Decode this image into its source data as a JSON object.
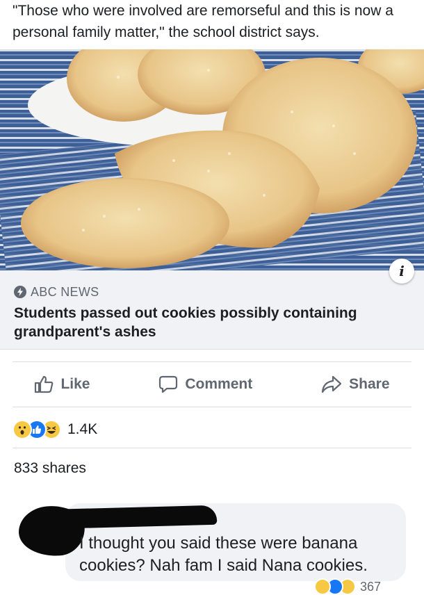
{
  "post": {
    "text": "\"Those who were involved are remorseful and this is now a personal family matter,\" the school district says."
  },
  "link_card": {
    "source": "ABC NEWS",
    "headline": "Students passed out cookies possibly containing grandparent's ashes",
    "image_icon": "cookies-photo",
    "info_icon": "i"
  },
  "actions": {
    "like_label": "Like",
    "comment_label": "Comment",
    "share_label": "Share"
  },
  "reactions": {
    "icons": [
      "wow-reaction-icon",
      "like-reaction-icon",
      "haha-reaction-icon"
    ],
    "count": "1.4K"
  },
  "shares": {
    "label": "833 shares"
  },
  "comment": {
    "text": "I thought you said these were banana cookies? Nah fam I said Nana cookies.",
    "reaction_count": "367"
  },
  "colors": {
    "meta_background": "#f0f2f5",
    "secondary_text": "#606770",
    "like_blue": "#1877f2",
    "reaction_yellow": "#f7c844"
  }
}
